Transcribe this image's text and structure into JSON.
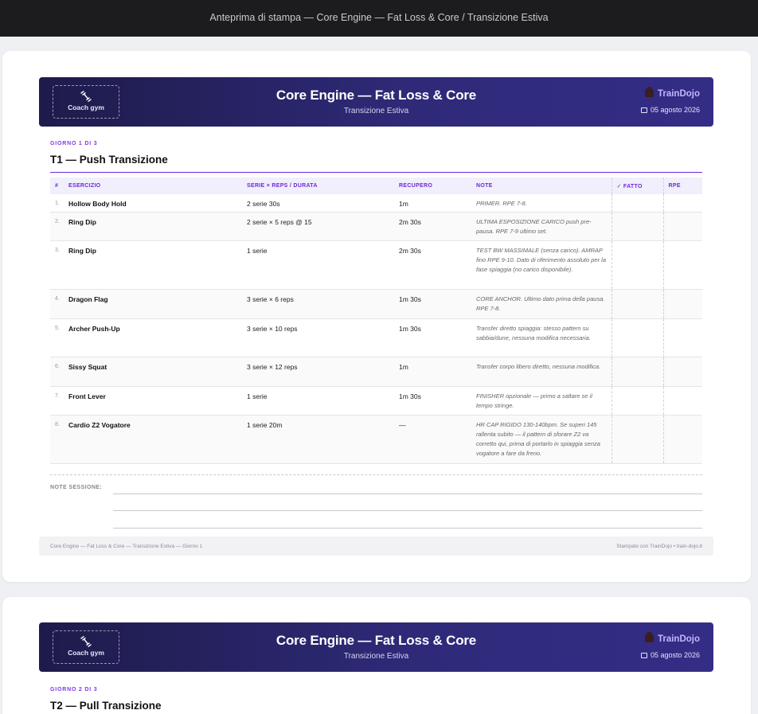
{
  "window": {
    "title": "Anteprima di stampa — Core Engine — Fat Loss & Core / Transizione Estiva"
  },
  "banner": {
    "coach_label": "Coach gym",
    "coach_icon": "dumbbell-icon",
    "title": "Core Engine — Fat Loss & Core",
    "subtitle": "Transizione Estiva",
    "brand": "TrainDojo",
    "brand_icon": "dojo-logo-icon",
    "date_icon": "calendar-icon",
    "date": "05 agosto 2026"
  },
  "table_headers": {
    "num": "#",
    "exercise": "ESERCIZIO",
    "sets": "SERIE × REPS / DURATA",
    "rest": "RECUPERO",
    "notes": "NOTE",
    "done": "✓ FATTO",
    "rpe": "RPE"
  },
  "day1": {
    "kicker": "GIORNO 1 DI 3",
    "title": "T1 — Push Transizione",
    "rows": [
      {
        "num": "1.",
        "name": "Hollow Body Hold",
        "sets": "2 serie 30s",
        "rest": "1m",
        "note": "PRIMER. RPE 7-8."
      },
      {
        "num": "2.",
        "name": "Ring Dip",
        "sets": "2 serie × 5 reps @ 15",
        "rest": "2m 30s",
        "note": "ULTIMA ESPOSIZIONE CARICO push pre-pausa. RPE 7-9 ultimo set."
      },
      {
        "num": "3.",
        "name": "Ring Dip",
        "sets": "1 serie",
        "rest": "2m 30s",
        "note": "TEST BW MASSIMALE (senza carico). AMRAP fino RPE 9-10. Dato di riferimento assoluto per la fase spiaggia (no carico disponibile)."
      },
      {
        "num": "4.",
        "name": "Dragon Flag",
        "sets": "3 serie × 6 reps",
        "rest": "1m 30s",
        "note": "CORE ANCHOR. Ultimo dato prima della pausa. RPE 7-8."
      },
      {
        "num": "5.",
        "name": "Archer Push-Up",
        "sets": "3 serie × 10 reps",
        "rest": "1m 30s",
        "note": "Transfer diretto spiaggia: stesso pattern su sabbia/dune, nessuna modifica necessaria."
      },
      {
        "num": "6.",
        "name": "Sissy Squat",
        "sets": "3 serie × 12 reps",
        "rest": "1m",
        "note": "Transfer corpo libero diretto, nessuna modifica."
      },
      {
        "num": "7.",
        "name": "Front Lever",
        "sets": "1 serie",
        "rest": "1m 30s",
        "note": "FINISHER opzionale — primo a saltare se il tempo stringe."
      },
      {
        "num": "8.",
        "name": "Cardio Z2 Vogatore",
        "sets": "1 serie 20m",
        "rest": "—",
        "note": "HR CAP RIGIDO 130-140bpm. Se superi 145 rallenta subito — il pattern di sforare Z2 va corretto qui, prima di portarlo in spiaggia senza vogatore a fare da freno."
      }
    ],
    "notes_label": "NOTE SESSIONE:",
    "footer_left": "Core Engine — Fat Loss & Core — Transizione Estiva — Giorno 1",
    "footer_right": "Stampato con TrainDojo • train-dojo.it"
  },
  "day2": {
    "kicker": "GIORNO 2 DI 3",
    "title": "T2 — Pull Transizione"
  }
}
